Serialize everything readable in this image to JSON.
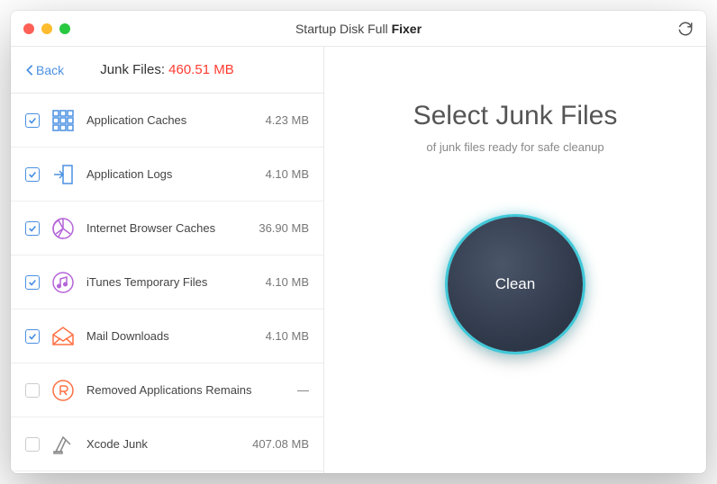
{
  "window": {
    "title_prefix": "Startup Disk Full ",
    "title_suffix": "Fixer"
  },
  "sidebar": {
    "back_label": "Back",
    "header_label": "Junk Files: ",
    "header_size": "460.51 MB",
    "items": [
      {
        "label": "Application Caches",
        "size": "4.23 MB",
        "checked": true,
        "icon_color": "#4a90e2"
      },
      {
        "label": "Application Logs",
        "size": "4.10 MB",
        "checked": true,
        "icon_color": "#4a90e2"
      },
      {
        "label": "Internet Browser Caches",
        "size": "36.90 MB",
        "checked": true,
        "icon_color": "#b565d8"
      },
      {
        "label": "iTunes Temporary Files",
        "size": "4.10 MB",
        "checked": true,
        "icon_color": "#b565d8"
      },
      {
        "label": "Mail Downloads",
        "size": "4.10 MB",
        "checked": true,
        "icon_color": "#ff7043"
      },
      {
        "label": "Removed Applications Remains",
        "size": "—",
        "checked": false,
        "icon_color": "#ff7043"
      },
      {
        "label": "Xcode Junk",
        "size": "407.08 MB",
        "checked": false,
        "icon_color": "#888888"
      }
    ]
  },
  "main": {
    "title": "Select Junk Files",
    "subtitle": "of junk files ready for safe cleanup",
    "clean_label": "Clean"
  }
}
